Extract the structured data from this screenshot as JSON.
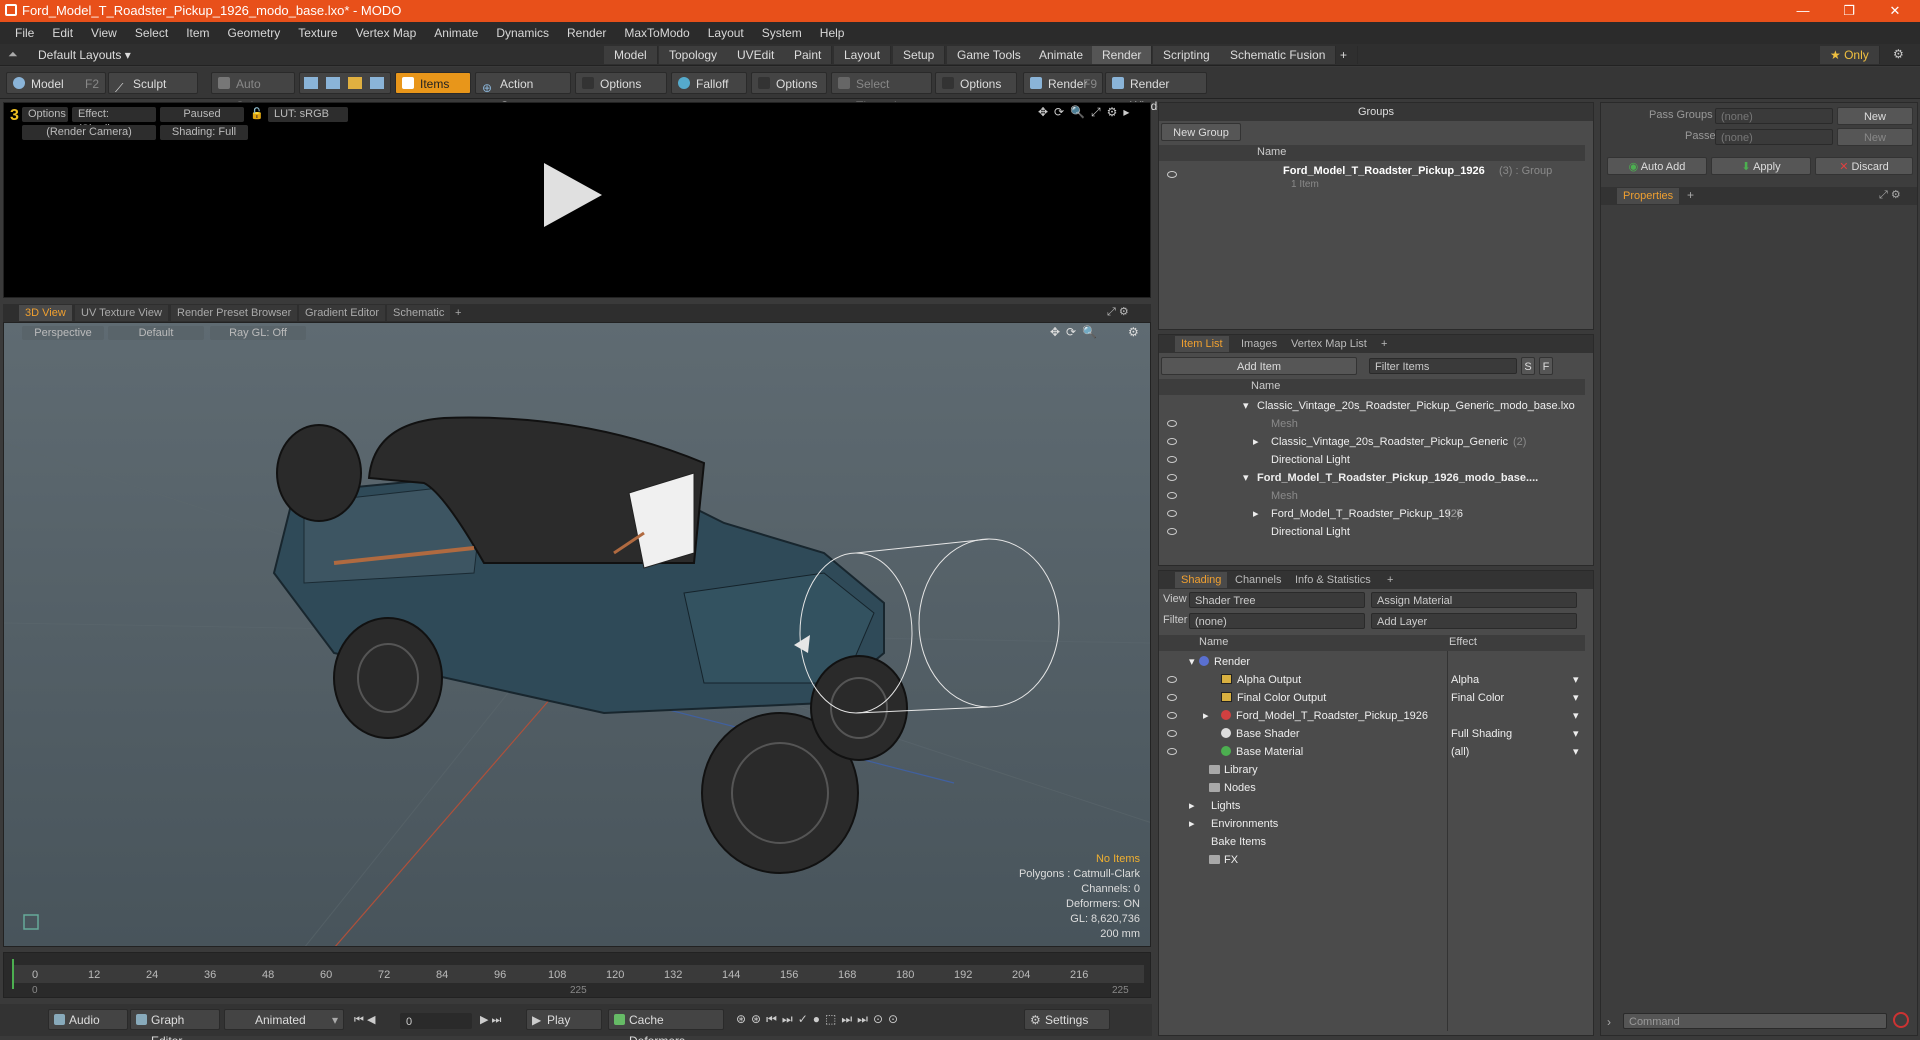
{
  "window": {
    "title": "Ford_Model_T_Roadster_Pickup_1926_modo_base.lxo* - MODO",
    "minimize": "—",
    "restore": "❐",
    "close": "✕"
  },
  "menu": [
    "File",
    "Edit",
    "View",
    "Select",
    "Item",
    "Geometry",
    "Texture",
    "Vertex Map",
    "Animate",
    "Dynamics",
    "Render",
    "MaxToModo",
    "Layout",
    "System",
    "Help"
  ],
  "layouts": {
    "selector": "Default Layouts ▾",
    "tabs": [
      "Model",
      "Topology",
      "UVEdit",
      "Paint",
      "Layout",
      "Setup",
      "Game Tools",
      "Animate",
      "Render",
      "Scripting",
      "Schematic Fusion",
      "+"
    ],
    "active": "Render",
    "only": "★ Only"
  },
  "toolbar": {
    "model": "Model",
    "model_key": "F2",
    "sculpt": "Sculpt",
    "auto_select": "Auto Select",
    "items": "Items",
    "action_center": "Action Center",
    "options1": "Options",
    "falloff": "Falloff",
    "options2": "Options",
    "select_through": "Select Through",
    "options3": "Options",
    "render": "Render",
    "render_key": "F9",
    "render_window": "Render Window"
  },
  "render_view": {
    "options": "Options",
    "effect": "Effect: (Shadi...",
    "paused": "Paused",
    "lut": "LUT: sRGB",
    "camera": "(Render Camera)",
    "shading": "Shading: Full"
  },
  "view_tabs": [
    "3D View",
    "UV Texture View",
    "Render Preset Browser",
    "Gradient Editor",
    "Schematic",
    "+"
  ],
  "view3d": {
    "perspective": "Perspective",
    "default": "Default",
    "raygl": "Ray GL: Off",
    "stats": {
      "no_items": "No Items",
      "polygons": "Polygons : Catmull-Clark",
      "channels": "Channels: 0",
      "deformers": "Deformers: ON",
      "gl": "GL: 8,620,736",
      "scale": "200 mm"
    }
  },
  "timeline": {
    "ticks": [
      "0",
      "12",
      "24",
      "36",
      "48",
      "60",
      "72",
      "84",
      "96",
      "108",
      "120",
      "132",
      "144",
      "156",
      "168",
      "180",
      "192",
      "204",
      "216"
    ],
    "sub_start": "0",
    "sub_mid": "225",
    "sub_end": "225"
  },
  "bottom": {
    "audio": "Audio",
    "graph_editor": "Graph Editor",
    "animated": "Animated",
    "frame": "0",
    "play": "Play",
    "cache_deformers": "Cache Deformers",
    "settings": "Settings"
  },
  "groups": {
    "title": "Groups",
    "new_group": "New Group",
    "col_name": "Name",
    "item_name": "Ford_Model_T_Roadster_Pickup_1926",
    "item_count": "(3) : Group",
    "item_sub": "1 Item"
  },
  "item_list": {
    "tabs": [
      "Item List",
      "Images",
      "Vertex Map List",
      "+"
    ],
    "add_item": "Add Item",
    "filter": "Filter Items",
    "s": "S",
    "f": "F",
    "col_name": "Name",
    "rows": [
      {
        "label": "Classic_Vintage_20s_Roadster_Pickup_Generic_modo_base.lxo",
        "extra": "",
        "style": "normal"
      },
      {
        "label": "Mesh",
        "extra": "",
        "style": "grey"
      },
      {
        "label": "Classic_Vintage_20s_Roadster_Pickup_Generic",
        "extra": "(2)",
        "style": "normal"
      },
      {
        "label": "Directional Light",
        "extra": "",
        "style": "normal"
      },
      {
        "label": "Ford_Model_T_Roadster_Pickup_1926_modo_base....",
        "extra": "",
        "style": "bold"
      },
      {
        "label": "Mesh",
        "extra": "",
        "style": "grey"
      },
      {
        "label": "Ford_Model_T_Roadster_Pickup_1926",
        "extra": "(2)",
        "style": "normal"
      },
      {
        "label": "Directional Light",
        "extra": "",
        "style": "normal"
      }
    ]
  },
  "shading": {
    "tabs": [
      "Shading",
      "Channels",
      "Info & Statistics",
      "+"
    ],
    "view_label": "View",
    "view_value": "Shader Tree",
    "assign": "Assign Material",
    "filter_label": "Filter",
    "filter_value": "(none)",
    "add_layer": "Add Layer",
    "col_name": "Name",
    "col_effect": "Effect",
    "rows": [
      {
        "label": "Render",
        "effect": ""
      },
      {
        "label": "Alpha Output",
        "effect": "Alpha"
      },
      {
        "label": "Final Color Output",
        "effect": "Final Color"
      },
      {
        "label": "Ford_Model_T_Roadster_Pickup_1926",
        "effect": ""
      },
      {
        "label": "Base Shader",
        "effect": "Full Shading"
      },
      {
        "label": "Base Material",
        "effect": "(all)"
      },
      {
        "label": "Library",
        "effect": ""
      },
      {
        "label": "Nodes",
        "effect": ""
      },
      {
        "label": "Lights",
        "effect": ""
      },
      {
        "label": "Environments",
        "effect": ""
      },
      {
        "label": "Bake Items",
        "effect": ""
      },
      {
        "label": "FX",
        "effect": ""
      }
    ]
  },
  "properties": {
    "pass_groups": "Pass Groups",
    "pass_groups_value": "(none)",
    "new1": "New",
    "passes": "Passes",
    "passes_value": "(none)",
    "new2": "New",
    "auto_add": "Auto Add",
    "apply": "Apply",
    "discard": "Discard",
    "tab": "Properties",
    "command": "Command"
  }
}
